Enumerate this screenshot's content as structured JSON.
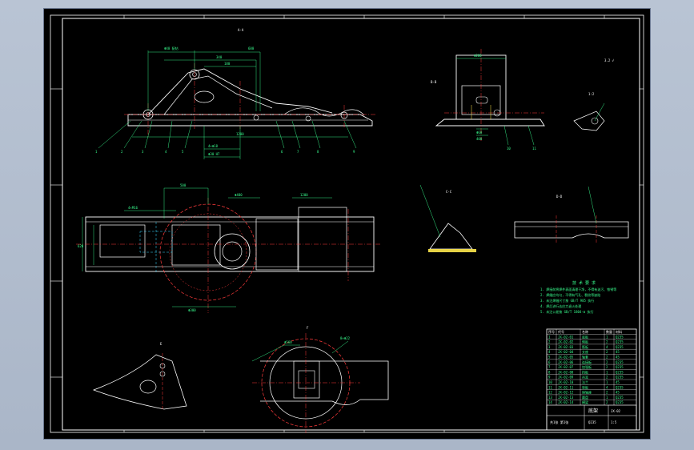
{
  "drawing": {
    "section_labels": {
      "top_view": "A-A",
      "right_view": "B-B",
      "detail_1": "C-C",
      "detail_2": "D-D",
      "bottom_left": "E",
      "bottom_center": "F",
      "small_detail": "1:2"
    },
    "roughness_mark": "3.2 √",
    "tech_notes_title": "技 术 要 求",
    "tech_notes": [
      "1. 焊接前将焊件表面清理干净，不得有油污、铁锈等",
      "2. 焊缝应均匀，不得有气孔、裂纹等缺陷",
      "3. 未注焊缝尺寸按 GB/T 985 执行",
      "4. 焊后进行去应力退火处理",
      "5. 未注公差按 GB/T 1804-m 执行"
    ],
    "title_block": {
      "name": "底架",
      "drawing_no": "JX-02",
      "material": "Q235",
      "scale": "1:5",
      "sheet": "共1张 第1张"
    },
    "parts_table": {
      "headers": [
        "序号",
        "代号",
        "名称",
        "数量",
        "材料"
      ],
      "rows": [
        [
          "1",
          "JX-02-01",
          "底板",
          "1",
          "Q235"
        ],
        [
          "2",
          "JX-02-02",
          "侧板",
          "2",
          "Q235"
        ],
        [
          "3",
          "JX-02-03",
          "筋板",
          "4",
          "Q235"
        ],
        [
          "4",
          "JX-02-04",
          "支座",
          "2",
          "45"
        ],
        [
          "5",
          "JX-02-05",
          "轴套",
          "2",
          "45"
        ],
        [
          "6",
          "JX-02-06",
          "连接板",
          "2",
          "Q235"
        ],
        [
          "7",
          "JX-02-07",
          "加强板",
          "2",
          "Q235"
        ],
        [
          "8",
          "JX-02-08",
          "挡板",
          "1",
          "Q235"
        ],
        [
          "9",
          "JX-02-09",
          "吊耳",
          "2",
          "Q235"
        ],
        [
          "10",
          "JX-02-10",
          "法兰",
          "1",
          "45"
        ],
        [
          "11",
          "JX-02-11",
          "垫板",
          "4",
          "Q235"
        ],
        [
          "12",
          "JX-02-12",
          "销轴座",
          "2",
          "45"
        ],
        [
          "13",
          "JX-02-13",
          "圆盘",
          "1",
          "Q235"
        ],
        [
          "14",
          "JX-02-14",
          "横梁",
          "2",
          "Q235"
        ]
      ]
    },
    "colors": {
      "paper": "#000000",
      "border": "#ffffff",
      "outline": "#ffffff",
      "dimension": "#39ff8f",
      "centerline": "#ff3b3b",
      "hidden": "#ffe94d",
      "cyan": "#3ad8ff",
      "hatch": "#ffe94d"
    }
  }
}
